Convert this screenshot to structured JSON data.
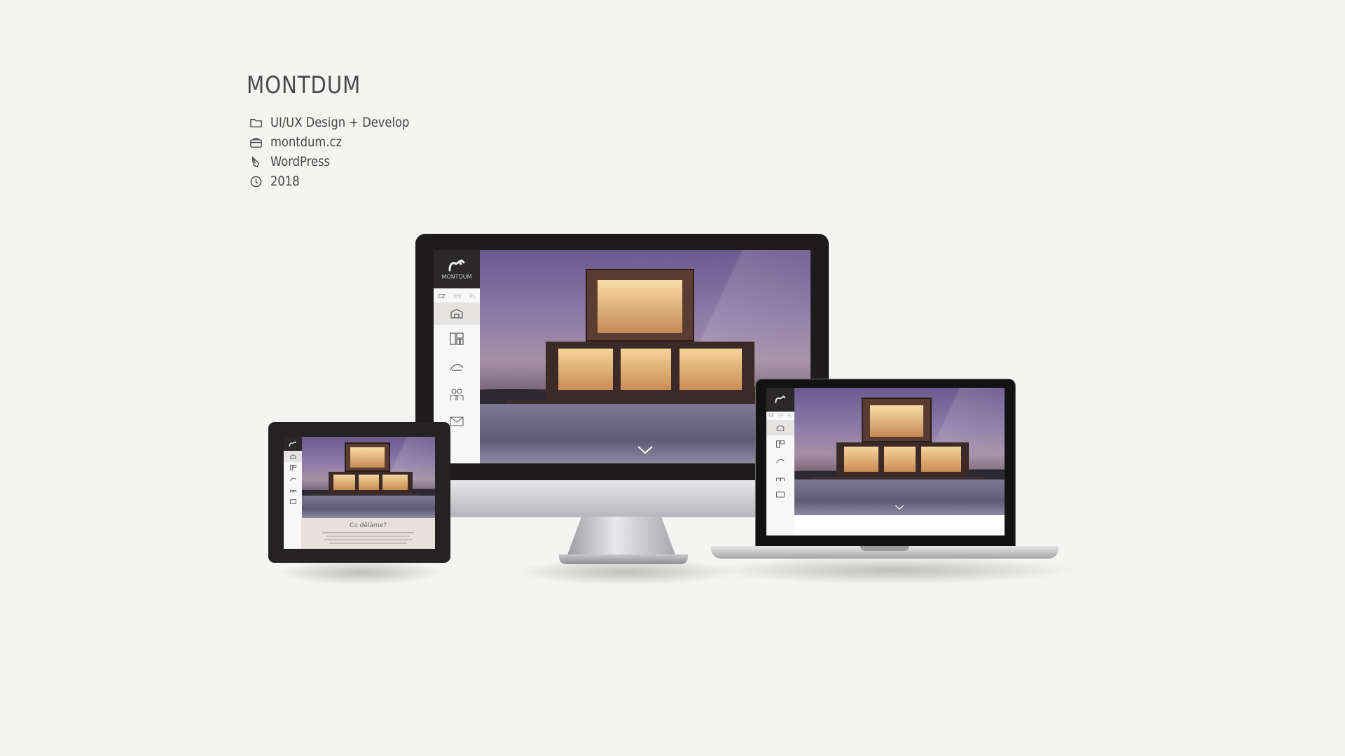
{
  "project": {
    "title": "MONTDUM",
    "meta": [
      {
        "icon": "folder-icon",
        "text": "UI/UX Design + Develop"
      },
      {
        "icon": "briefcase-icon",
        "text": "montdum.cz"
      },
      {
        "icon": "pen-icon",
        "text": "WordPress"
      },
      {
        "icon": "clock-icon",
        "text": "2018"
      }
    ]
  },
  "site": {
    "logo_text": "MONTDUM",
    "languages": [
      "CZ",
      "EN",
      "PL"
    ],
    "tablet_heading": "Co děláme?"
  },
  "colors": {
    "background": "#f4f4f2",
    "text": "#4a4a4a",
    "sidebar_dark": "#2a2829"
  }
}
